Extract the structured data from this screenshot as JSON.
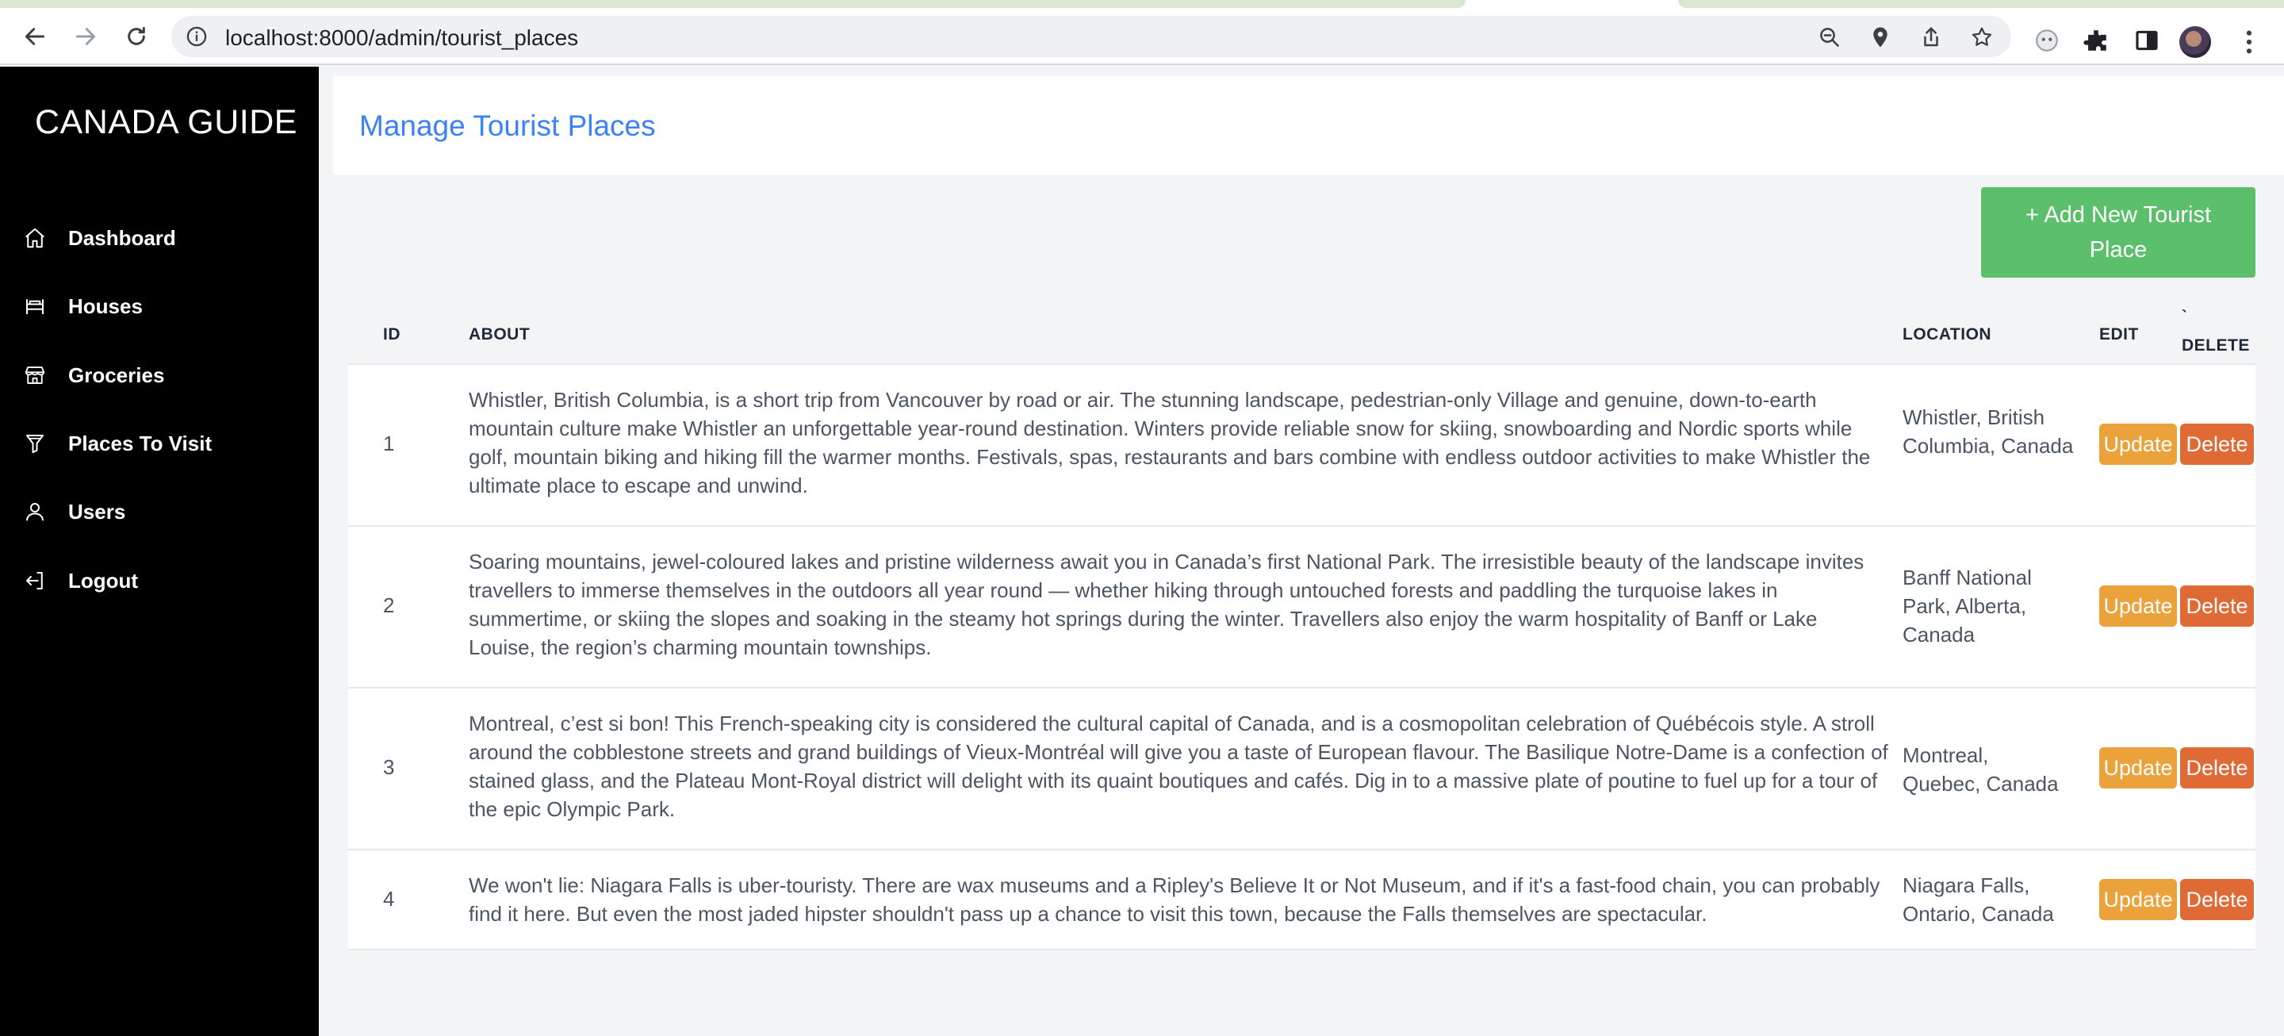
{
  "browser": {
    "url": "localhost:8000/admin/tourist_places"
  },
  "sidebar": {
    "brand": "CANADA GUIDE",
    "items": [
      {
        "label": "Dashboard",
        "icon": "home-icon"
      },
      {
        "label": "Houses",
        "icon": "bed-icon"
      },
      {
        "label": "Groceries",
        "icon": "store-icon"
      },
      {
        "label": "Places To Visit",
        "icon": "filter-icon"
      },
      {
        "label": "Users",
        "icon": "user-icon"
      },
      {
        "label": "Logout",
        "icon": "logout-icon"
      }
    ]
  },
  "header": {
    "title": "Manage Tourist Places"
  },
  "toolbar": {
    "add_label": "+ Add New Tourist Place"
  },
  "table": {
    "columns": {
      "id": "ID",
      "about": "ABOUT",
      "location": "LOCATION",
      "edit": "EDIT",
      "delete_tick": "`",
      "delete": "DELETE"
    },
    "update_label": "Update",
    "delete_label": "Delete",
    "rows": [
      {
        "id": "1",
        "about": "Whistler, British Columbia, is a short trip from Vancouver by road or air. The stunning landscape, pedestrian-only Village and genuine, down-to-earth mountain culture make Whistler an unforgettable year-round destination. Winters provide reliable snow for skiing, snowboarding and Nordic sports while golf, mountain biking and hiking fill the warmer months. Festivals, spas, restaurants and bars combine with endless outdoor activities to make Whistler the ultimate place to escape and unwind.",
        "location": "Whistler, British Columbia, Canada"
      },
      {
        "id": "2",
        "about": "Soaring mountains, jewel-coloured lakes and pristine wilderness await you in Canada’s first National Park. The irresistible beauty of the landscape invites travellers to immerse themselves in the outdoors all year round — whether hiking through untouched forests and paddling the turquoise lakes in summertime, or skiing the slopes and soaking in the steamy hot springs during the winter. Travellers also enjoy the warm hospitality of Banff or Lake Louise, the region’s charming mountain townships.",
        "location": "Banff National Park, Alberta, Canada"
      },
      {
        "id": "3",
        "about": "Montreal, c’est si bon! This French-speaking city is considered the cultural capital of Canada, and is a cosmopolitan celebration of Québécois style. A stroll around the cobblestone streets and grand buildings of Vieux-Montréal will give you a taste of European flavour. The Basilique Notre-Dame is a confection of stained glass, and the Plateau Mont-Royal district will delight with its quaint boutiques and cafés. Dig in to a massive plate of poutine to fuel up for a tour of the epic Olympic Park.",
        "location": "Montreal, Quebec, Canada"
      },
      {
        "id": "4",
        "about": "We won't lie: Niagara Falls is uber-touristy. There are wax museums and a Ripley's Believe It or Not Museum, and if it's a fast-food chain, you can probably find it here. But even the most jaded hipster shouldn't pass up a chance to visit this town, because the Falls themselves are spectacular.",
        "location": "Niagara Falls, Ontario, Canada"
      }
    ]
  },
  "colors": {
    "sidebar_bg": "#000000",
    "title_blue": "#3b82f6",
    "add_green": "#5cbf6b",
    "update_orange": "#eba23b",
    "delete_orange": "#df6a35"
  }
}
